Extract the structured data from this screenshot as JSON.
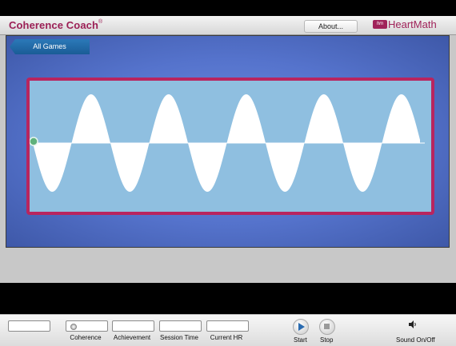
{
  "app": {
    "title": "Coherence Coach",
    "reg_mark": "®",
    "about_button": "About...",
    "brand_mark": "hm",
    "brand_name": "HeartMath"
  },
  "game": {
    "back_button": "All Games"
  },
  "metrics": [
    {
      "label": "",
      "value": ""
    },
    {
      "label": "Coherence",
      "value": ""
    },
    {
      "label": "Achievement",
      "value": ""
    },
    {
      "label": "Session Time",
      "value": ""
    },
    {
      "label": "Current HR",
      "value": ""
    }
  ],
  "controls": {
    "start_label": "Start",
    "stop_label": "Stop",
    "sound_label": "Sound On/Off"
  },
  "colors": {
    "brand": "#9b1f55",
    "frame": "#b8255f",
    "wave_bg": "#8fbfe0",
    "wave": "#ffffff",
    "back_button": "#1f66a3"
  },
  "icons": [
    "play-icon",
    "stop-icon",
    "speaker-icon",
    "coherence-indicator-icon"
  ]
}
